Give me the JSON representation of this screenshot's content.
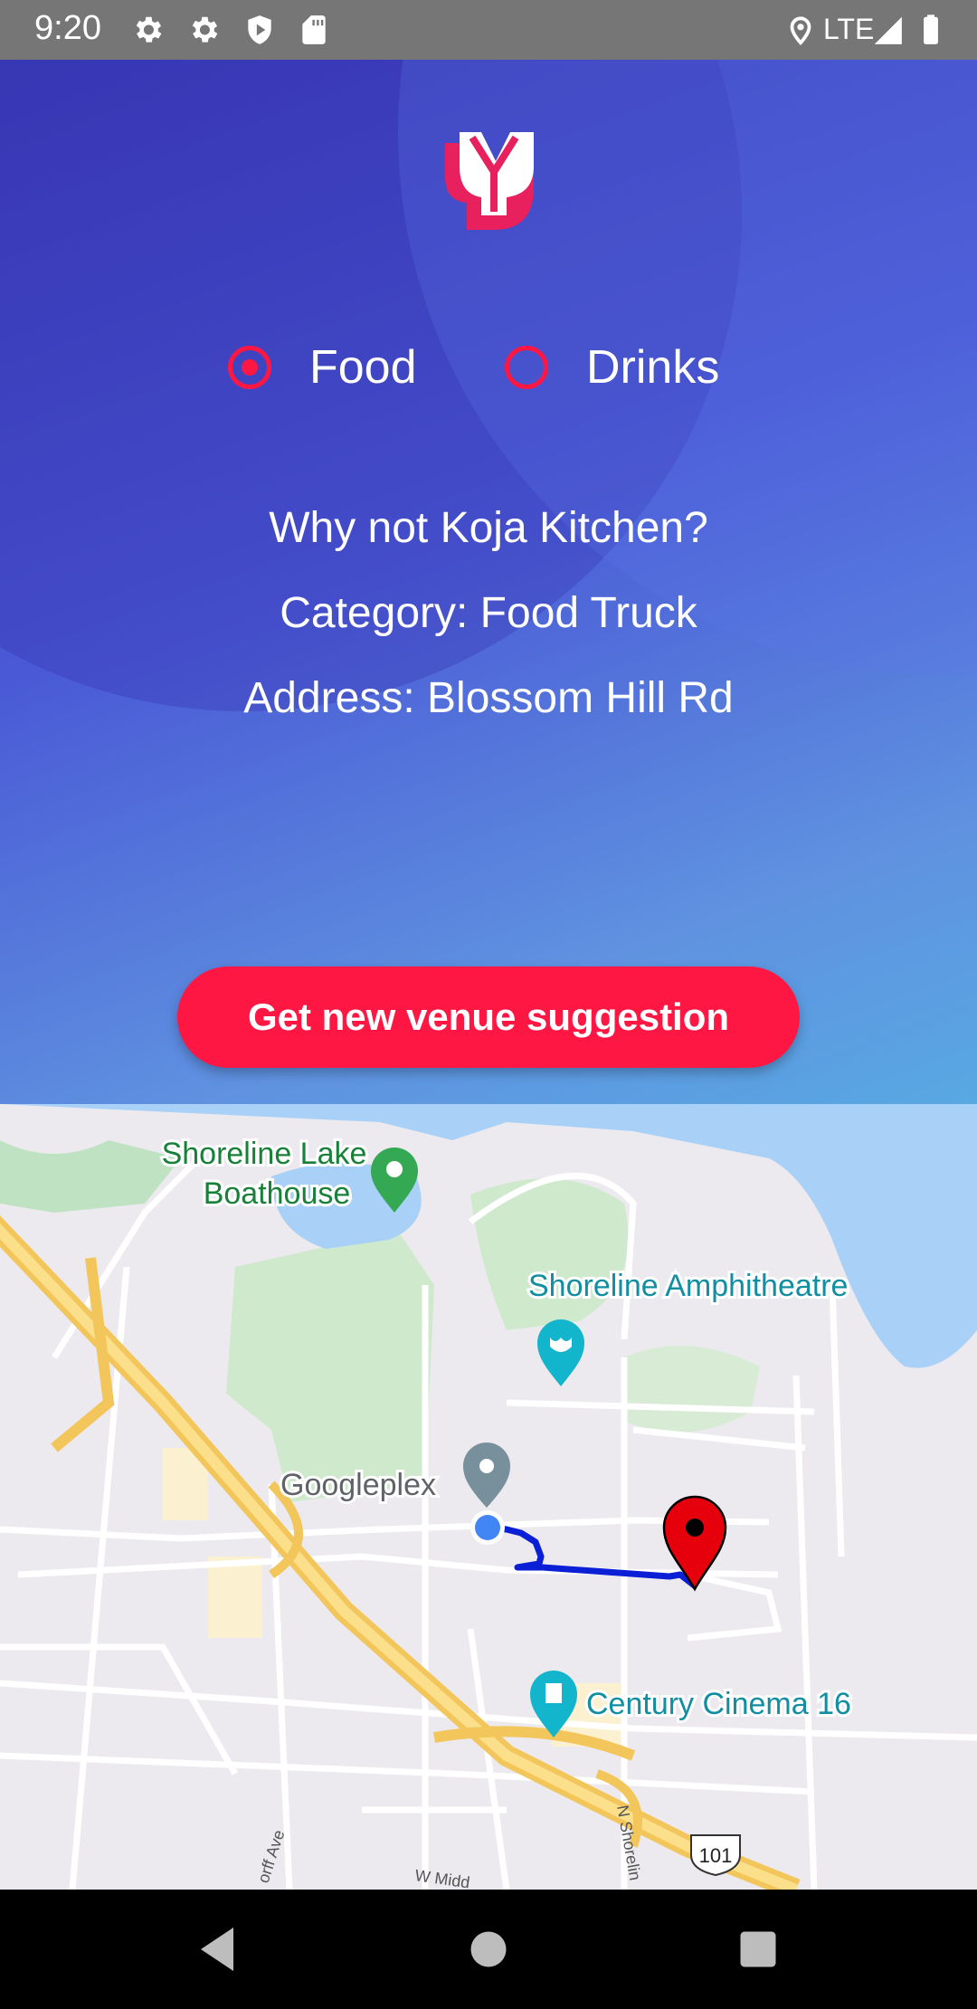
{
  "status_bar": {
    "time": "9:20",
    "network": "LTE"
  },
  "radio_options": [
    {
      "label": "Food",
      "checked": true
    },
    {
      "label": "Drinks",
      "checked": false
    }
  ],
  "suggestion": {
    "line1": "Why not Koja Kitchen?",
    "line2": "Category: Food Truck",
    "line3": "Address: Blossom Hill Rd"
  },
  "cta_label": "Get new venue suggestion",
  "map": {
    "labels": {
      "lake_boathouse_1": "Shoreline Lake",
      "lake_boathouse_2": "Boathouse",
      "amphitheatre": "Shoreline Amphitheatre",
      "googleplex": "Googleplex",
      "cinema": "Century Cinema 16",
      "highway": "101",
      "street_shoreline": "N Shorelin",
      "street_w_middle": "W Midd",
      "street_ave": "orff Ave"
    }
  },
  "colors": {
    "accent": "#ff1744",
    "route": "#0b1fd6",
    "pin": "#e6000b"
  }
}
